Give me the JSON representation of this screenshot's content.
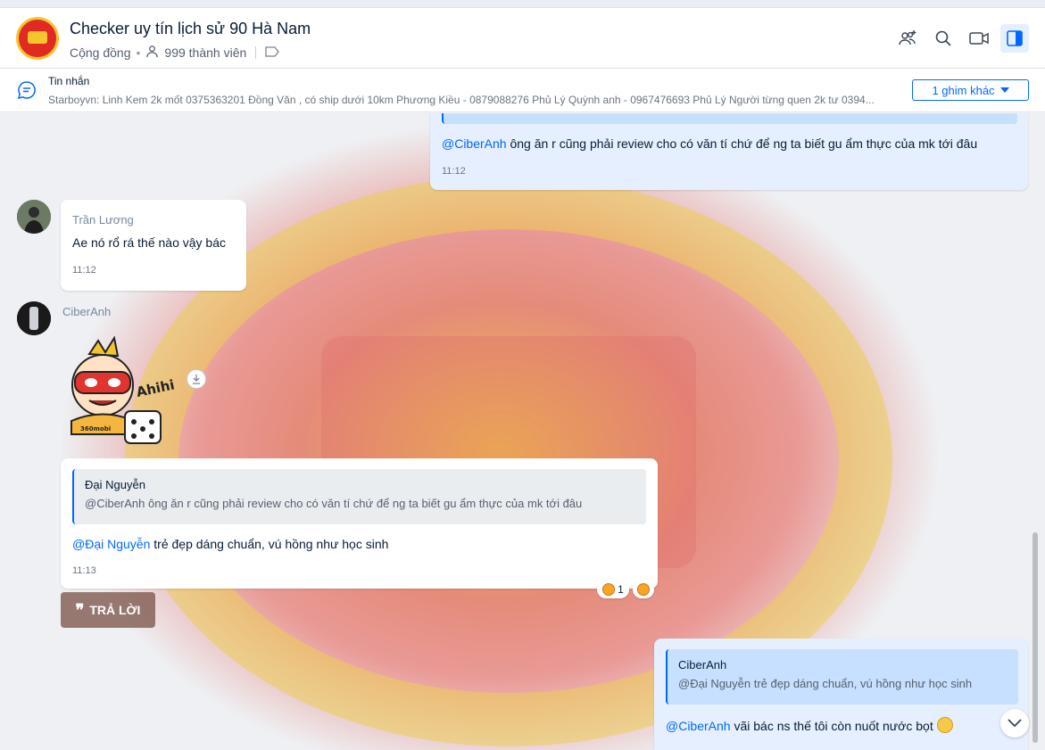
{
  "header": {
    "title": "Checker uy tín lịch sử 90 Hà Nam",
    "type": "Cộng đồng",
    "members": "999 thành viên",
    "icons": [
      "add-member-icon",
      "search-icon",
      "video-call-icon",
      "sidebar-toggle-icon"
    ]
  },
  "pinned": {
    "title": "Tin nhắn",
    "text": "Starboyvn: Linh Kem 2k mốt 0375363201 Đồng Văn , có ship dưới 10km Phương Kiều - 0879088276 Phủ Lý Quỳnh anh - 0967476693 Phủ Lý Người từng quen 2k tư 0394...",
    "more_button": "1 ghim khác"
  },
  "messages": [
    {
      "mention": "@CiberAnh",
      "text": " ông ăn r cũng phải review cho có văn tí chứ để ng ta biết gu ẩm thực của mk tới đâu",
      "time": "11:12"
    },
    {
      "sender": "Trần Lương",
      "text": "Ae nó rổ rá thế nào vậy bác",
      "time": "11:12"
    },
    {
      "sender": "CiberAnh",
      "sticker": "Ahihi",
      "sticker_brand": "360mobi"
    },
    {
      "quote_name": "Đại Nguyễn",
      "quote_text": "@CiberAnh ông ăn r cũng phải review cho có văn tí chứ để ng ta biết gu ẩm thực của mk tới đâu",
      "mention": "@Đại Nguyễn",
      "text": " trẻ đẹp dáng chuẩn, vú hồng như học sinh",
      "time": "11:13",
      "reaction_count": "1"
    },
    {
      "quote_name": "CiberAnh",
      "quote_text": "@Đại Nguyễn trẻ đẹp dáng chuẩn, vú hồng như học sinh",
      "mention": "@CiberAnh",
      "text": " vãi bác ns thế tôi còn nuốt nước bọt"
    }
  ],
  "reply_button": "TRẢ LỜI",
  "colors": {
    "accent": "#0068ff",
    "my_bubble": "#e5efff",
    "other_bubble": "#ffffff"
  }
}
